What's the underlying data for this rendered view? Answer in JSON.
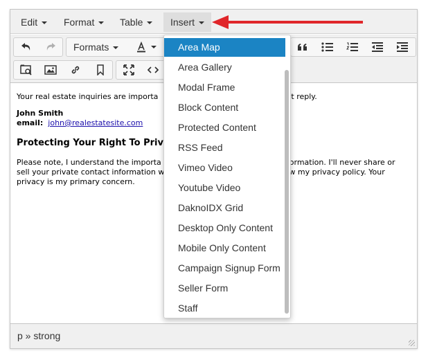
{
  "menubar": {
    "items": [
      {
        "label": "Edit"
      },
      {
        "label": "Format"
      },
      {
        "label": "Table"
      },
      {
        "label": "Insert"
      }
    ]
  },
  "toolbar": {
    "formats_label": "Formats",
    "icons": [
      "undo-icon",
      "redo-icon",
      "font-color-icon",
      "blockquote-icon",
      "bullet-list-icon",
      "numbered-list-icon",
      "outdent-icon",
      "indent-icon",
      "image-gallery-icon",
      "image-icon",
      "link-icon",
      "bookmark-icon",
      "fullscreen-icon",
      "code-icon"
    ]
  },
  "content": {
    "intro_left": "Your real estate inquiries are importa",
    "intro_right": "pt reply.",
    "name": "John Smith",
    "email_label": "email:",
    "email": "john@realestatesite.com",
    "heading": "Protecting Your Right To Priv",
    "body_left_1": "Please note, I understand the importa",
    "body_right_1": "ormation. I'll never share or",
    "body_left_2": "sell your private contact information w",
    "body_right_2": "w my privacy policy. Your",
    "body_3": "privacy is my primary concern."
  },
  "statusbar": {
    "path": "p » strong"
  },
  "insert_menu": {
    "items": [
      {
        "label": "Area Map",
        "selected": true
      },
      {
        "label": "Area Gallery"
      },
      {
        "label": "Modal Frame"
      },
      {
        "label": "Block Content"
      },
      {
        "label": "Protected Content"
      },
      {
        "label": "RSS Feed"
      },
      {
        "label": "Vimeo Video"
      },
      {
        "label": "Youtube Video"
      },
      {
        "label": "DaknoIDX Grid"
      },
      {
        "label": "Desktop Only Content"
      },
      {
        "label": "Mobile Only Content"
      },
      {
        "label": "Campaign Signup Form"
      },
      {
        "label": "Seller Form"
      },
      {
        "label": "Staff"
      }
    ]
  },
  "colors": {
    "selected_bg": "#1b84c4",
    "annotation_arrow": "#e0262a"
  }
}
